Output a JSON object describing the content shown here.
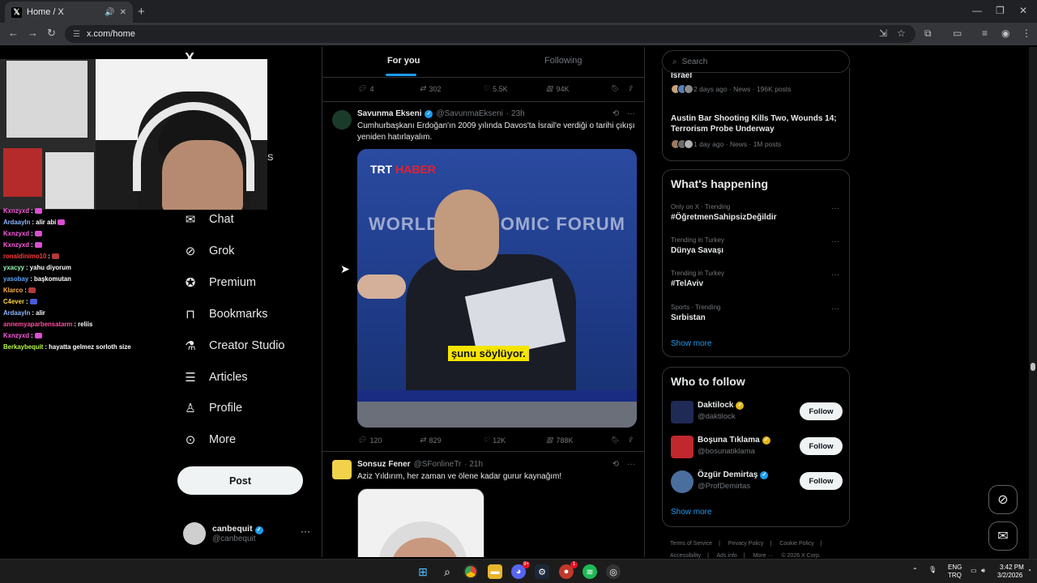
{
  "browser": {
    "tab_title": "Home / X",
    "url": "x.com/home",
    "new_tab": "+",
    "window_controls": [
      "minimize-icon",
      "maximize-icon",
      "close-icon"
    ]
  },
  "nav": {
    "logo": "X",
    "items": [
      {
        "label": "Chat",
        "icon": "envelope-icon"
      },
      {
        "label": "Grok",
        "icon": "grok-icon"
      },
      {
        "label": "Premium",
        "icon": "verified-badge-icon"
      },
      {
        "label": "Bookmarks",
        "icon": "bookmark-icon"
      },
      {
        "label": "Creator Studio",
        "icon": "flask-icon"
      },
      {
        "label": "Articles",
        "icon": "article-icon"
      },
      {
        "label": "Profile",
        "icon": "person-icon"
      },
      {
        "label": "More",
        "icon": "more-circle-icon"
      }
    ],
    "post_label": "Post",
    "account": {
      "name": "canbequit",
      "handle": "@canbequit",
      "more": "···"
    }
  },
  "stream_overlay": {
    "cam_label": "S",
    "chat": [
      {
        "user": "Kxnzyxd",
        "msg": ":",
        "color": "#ff5ce1"
      },
      {
        "user": "Ardaayln",
        "msg": ": alir abi",
        "color": "#8fb6ff"
      },
      {
        "user": "Kxnzyxd",
        "msg": ":",
        "color": "#ff5ce1"
      },
      {
        "user": "Kxnzyxd",
        "msg": ":",
        "color": "#ff5ce1"
      },
      {
        "user": "ronaldinimo10",
        "msg": ":",
        "color": "#ff3b3b"
      },
      {
        "user": "yxacyy",
        "msg": ": yahu diyorum",
        "color": "#9cf7b8"
      },
      {
        "user": "yasobay",
        "msg": ": başkomutan",
        "color": "#5aa7ff"
      },
      {
        "user": "Klarco",
        "msg": ":",
        "color": "#ffb347"
      },
      {
        "user": "C4ever",
        "msg": ":",
        "color": "#ffd24a"
      },
      {
        "user": "Ardaayln",
        "msg": ": alir",
        "color": "#8fb6ff"
      },
      {
        "user": "annemyaparbensatarm",
        "msg": ": reliis",
        "color": "#ff4fa0"
      },
      {
        "user": "Kxnzyxd",
        "msg": ":",
        "color": "#ff5ce1"
      },
      {
        "user": "Berkaybequit",
        "msg": ": hayatta gelmez sorloth size",
        "color": "#b5f84a"
      }
    ]
  },
  "timeline": {
    "tabs": [
      "For you",
      "Following"
    ],
    "prev_actions": {
      "replies": "4",
      "reposts": "302",
      "likes": "5.5K",
      "views": "94K"
    },
    "tweets": [
      {
        "name": "Savunma Ekseni",
        "handle": "@SavunmaEkseni",
        "time": "· 23h",
        "text": "Cumhurbaşkanı Erdoğan'ın 2009 yılında Davos'ta İsrail'e verdiği o tarihi çıkışı yeniden hatırlayalım.",
        "media": {
          "logo_a": "TRT",
          "logo_b": "HABER",
          "backdrop": "WORLD ECONOMIC FORUM",
          "subtitle": "şunu söylüyor."
        },
        "actions": {
          "replies": "120",
          "reposts": "829",
          "likes": "12K",
          "views": "788K"
        }
      },
      {
        "name": "Sonsuz Fener",
        "handle": "@SFonlineTr",
        "time": "· 21h",
        "text": "Aziz Yıldırım, her zaman ve ölene kadar gurur kaynağım!"
      }
    ]
  },
  "sidebar": {
    "search_placeholder": "Search",
    "news": [
      {
        "title": "Israel",
        "meta": "2 days ago · News · 196K posts"
      },
      {
        "title": "Austin Bar Shooting Kills Two, Wounds 14; Terrorism Probe Underway",
        "meta": "1 day ago · News · 1M posts"
      }
    ],
    "happening": {
      "title": "What's happening",
      "trends": [
        {
          "context": "Only on X · Trending",
          "name": "#ÖğretmenSahipsizDeğildir"
        },
        {
          "context": "Trending in Turkey",
          "name": "Dünya Savaşı"
        },
        {
          "context": "Trending in Turkey",
          "name": "#TelAviv"
        },
        {
          "context": "Sports · Trending",
          "name": "Sırbistan"
        }
      ],
      "show_more": "Show more"
    },
    "who_to_follow": {
      "title": "Who to follow",
      "accounts": [
        {
          "name": "Daktilock",
          "handle": "@daktilock",
          "badge": "gold",
          "avatar_color": "#1f2a55"
        },
        {
          "name": "Boşuna Tıklama",
          "handle": "@bosunatiklama",
          "badge": "gold",
          "avatar_color": "#c0282e"
        },
        {
          "name": "Özgür Demirtaş",
          "handle": "@ProfDemirtas",
          "badge": "blue",
          "avatar_color": "#4a6f9e"
        }
      ],
      "follow_label": "Follow",
      "show_more": "Show more"
    },
    "footer": [
      "Terms of Service",
      "|",
      "Privacy Policy",
      "|",
      "Cookie Policy",
      "|",
      "Accessibility",
      "|",
      "Ads info",
      "|",
      "More ···",
      "© 2026 X Corp."
    ]
  },
  "taskbar": {
    "lang_top": "ENG",
    "lang_bottom": "TRQ",
    "time": "3:42 PM",
    "date": "3/2/2026",
    "badges": {
      "discord": "9+",
      "app": "1"
    }
  }
}
